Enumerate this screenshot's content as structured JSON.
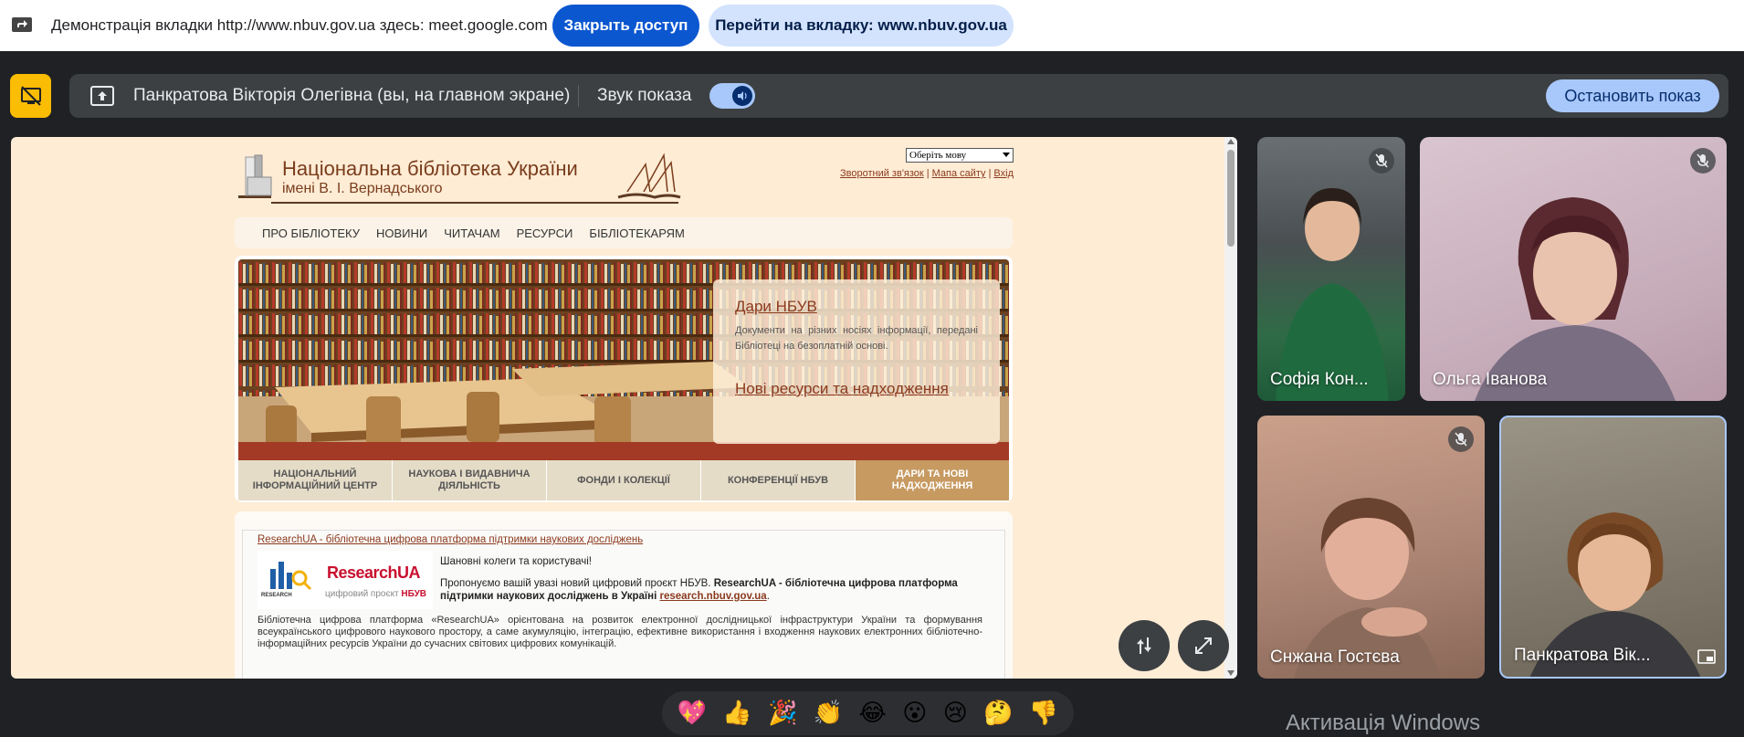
{
  "share_bar": {
    "text": "Демонстрація вкладки http://www.nbuv.gov.ua здесь: meet.google.com",
    "stop_access": "Закрыть доступ",
    "go_tab": "Перейти на вкладку: www.nbuv.gov.ua"
  },
  "presenting": {
    "name": "Панкратова Вікторія Олегівна (вы, на главном экране)",
    "sound_label": "Звук показа",
    "sound_on": true,
    "stop_button": "Остановить показ"
  },
  "site": {
    "lang_select": "Оберіть мову",
    "top_links": [
      "Зворотний зв'язок",
      "Мапа сайту",
      "Вхід"
    ],
    "logo_title": "Національна бібліотека України",
    "logo_subtitle": "імені В. І. Вернадського",
    "nav": [
      "ПРО БІБЛІОТЕКУ",
      "НОВИНИ",
      "ЧИТАЧАМ",
      "РЕСУРСИ",
      "БІБЛІОТЕКАРЯМ"
    ],
    "hero": {
      "link1": "Дари НБУВ",
      "desc": "Документи на різних носіях інформації, передані Бібліотеці на безоплатній основі.",
      "link2": "Нові ресурси та надходження"
    },
    "tabs": [
      {
        "line1": "НАЦІОНАЛЬНИЙ",
        "line2": "ІНФОРМАЦІЙНИЙ ЦЕНТР"
      },
      {
        "line1": "НАУКОВА І ВИДАВНИЧА",
        "line2": "ДІЯЛЬНІСТЬ"
      },
      {
        "line1": "ФОНДИ І КОЛЕКЦІЇ",
        "line2": ""
      },
      {
        "line1": "КОНФЕРЕНЦІЇ НБУВ",
        "line2": ""
      },
      {
        "line1": "ДАРИ ТА НОВІ",
        "line2": "НАДХОДЖЕННЯ"
      }
    ],
    "news": {
      "title": "ResearchUA - бібліотечна цифрова платформа підтримки наукових досліджень",
      "logo_name": "ResearchUA",
      "logo_small": "RESEARCH",
      "logo_project": "цифровий проєкт",
      "logo_nbuv": "НБУВ",
      "greeting": "Шановні колеги та користувачі!",
      "p1_start": "Пропонуємо вашій увазі новий цифровий проєкт НБУВ.",
      "p1_bold": "ResearchUA - бібліотечна цифрова платформа підтримки наукових досліджень в Україні",
      "p1_link": "research.nbuv.gov.ua",
      "p2": "Бібліотечна цифрова платформа «ResearchUA» орієнтована на розвиток електронної дослідницької інфраструктури України та формування всеукраїнського цифрового наукового простору, а саме акумуляцію, інтеграцію, ефективне використання і входження наукових електронних бібліотечно-інформаційних ресурсів України до сучасних світових цифрових комунікацій."
    }
  },
  "participants": [
    {
      "name": "Софія Кон...",
      "muted": true
    },
    {
      "name": "Ольга Іванова",
      "muted": true
    },
    {
      "name": "Снжана Гостєва",
      "muted": true
    },
    {
      "name": "Панкратова Вік...",
      "muted": false
    }
  ],
  "reactions": [
    "💖",
    "👍",
    "🎉",
    "👏",
    "😂",
    "😮",
    "😢",
    "🤔",
    "👎"
  ],
  "watermark": "Активація Windows",
  "colors": {
    "accent": "#0b57d0",
    "presenting": "#fbbc04",
    "site_bg": "#feecd5",
    "site_link": "#8b3a1e"
  }
}
